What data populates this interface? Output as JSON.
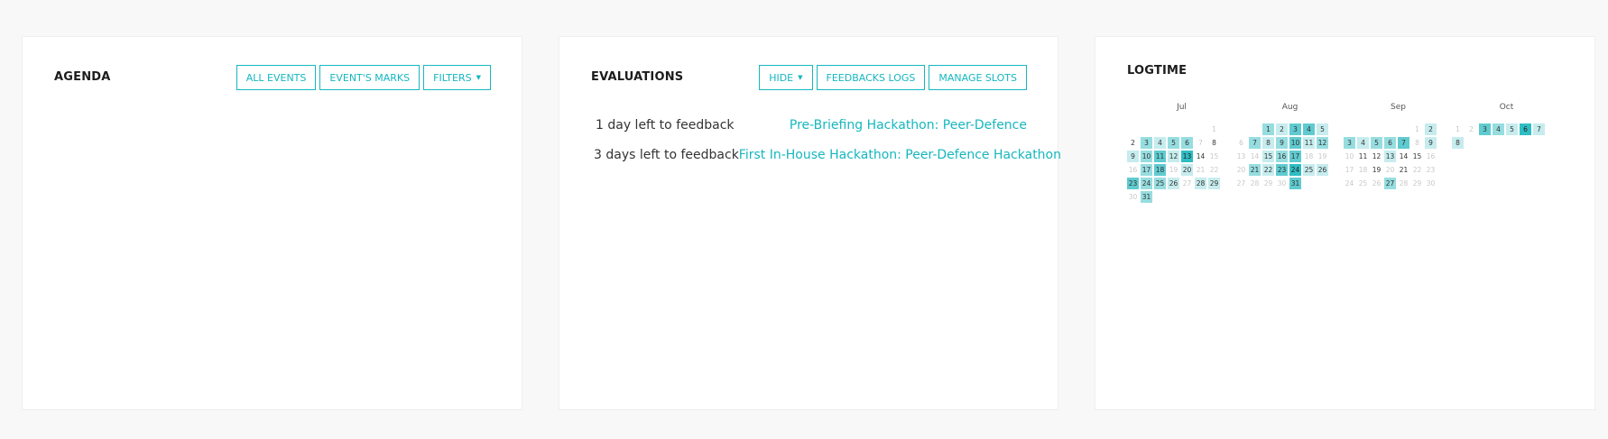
{
  "agenda": {
    "title": "AGENDA",
    "buttons": {
      "all_events": "ALL EVENTS",
      "events_marks": "EVENT'S MARKS",
      "filters": "FILTERS"
    }
  },
  "evaluations": {
    "title": "EVALUATIONS",
    "buttons": {
      "hide": "HIDE",
      "feedbacks_logs": "FEEDBACKS LOGS",
      "manage_slots": "MANAGE SLOTS"
    },
    "items": [
      {
        "left": "1 day left to feedback",
        "right": "Pre-Briefing Hackathon: Peer-Defence"
      },
      {
        "left": "3 days left to feedback",
        "right": "First In-House Hackathon: Peer-Defence Hackathon"
      }
    ]
  },
  "logtime": {
    "title": "LOGTIME",
    "months": [
      {
        "label": "Jul",
        "offset": 6,
        "days": 31,
        "levels": {
          "2": 0,
          "3": 2,
          "4": 1,
          "5": 2,
          "6": 2,
          "8": 0,
          "9": 1,
          "10": 2,
          "11": 3,
          "12": 1,
          "13": 4,
          "14": 0,
          "17": 2,
          "18": 3,
          "20": 1,
          "23": 3,
          "24": 2,
          "25": 2,
          "26": 1,
          "28": 1,
          "29": 1,
          "31": 2
        }
      },
      {
        "label": "Aug",
        "offset": 2,
        "days": 31,
        "levels": {
          "1": 2,
          "2": 1,
          "3": 3,
          "4": 3,
          "5": 1,
          "7": 2,
          "8": 1,
          "9": 2,
          "10": 3,
          "11": 1,
          "12": 2,
          "15": 1,
          "16": 2,
          "17": 3,
          "21": 2,
          "22": 1,
          "23": 3,
          "24": 4,
          "25": 1,
          "26": 1,
          "31": 3
        }
      },
      {
        "label": "Sep",
        "offset": 5,
        "days": 30,
        "levels": {
          "2": 1,
          "3": 2,
          "4": 1,
          "5": 2,
          "6": 2,
          "7": 3,
          "9": 1,
          "11": 0,
          "12": 0,
          "13": 1,
          "14": 0,
          "15": 0,
          "19": 0,
          "21": 0,
          "27": 2
        }
      },
      {
        "label": "Oct",
        "offset": 0,
        "days": 8,
        "levels": {
          "3": 3,
          "4": 2,
          "5": 1,
          "6": 4,
          "7": 1,
          "8": 1
        }
      }
    ]
  }
}
